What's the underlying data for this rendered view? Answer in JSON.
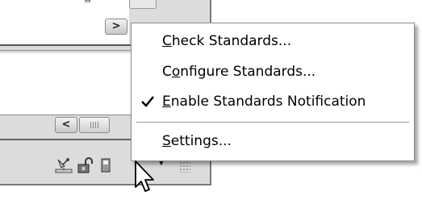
{
  "menu": {
    "items": [
      {
        "label": "Check Standards...",
        "mnemonic": "C",
        "checked": false
      },
      {
        "label": "Configure Standards...",
        "mnemonic": "o",
        "checked": false
      },
      {
        "label": "Enable Standards Notification",
        "mnemonic": "E",
        "checked": true
      },
      {
        "label": "Settings...",
        "mnemonic": "S",
        "checked": false
      }
    ]
  },
  "statusbar": {
    "icons": [
      "satellite-icon",
      "unlock-icon",
      "cad-standards-icon",
      "chevron-down-icon",
      "resize-grip-icon"
    ]
  },
  "scrollbars": {
    "right_arrow": ">",
    "left_arrow": "<"
  }
}
